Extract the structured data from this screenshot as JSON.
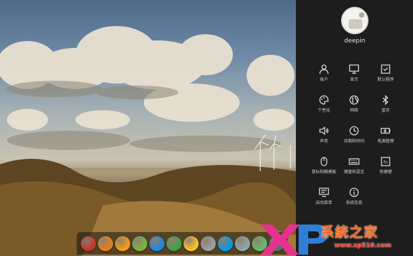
{
  "user": {
    "name": "deepin"
  },
  "settings": [
    {
      "id": "accounts",
      "label": "账户",
      "icon": "user-icon"
    },
    {
      "id": "display",
      "label": "显示",
      "icon": "monitor-icon"
    },
    {
      "id": "default-apps",
      "label": "默认程序",
      "icon": "check-window-icon"
    },
    {
      "id": "personalization",
      "label": "个性化",
      "icon": "palette-icon"
    },
    {
      "id": "network",
      "label": "网络",
      "icon": "globe-icon"
    },
    {
      "id": "bluetooth",
      "label": "蓝牙",
      "icon": "bluetooth-icon"
    },
    {
      "id": "sound",
      "label": "声音",
      "icon": "speaker-icon"
    },
    {
      "id": "datetime",
      "label": "日期和时间",
      "icon": "clock-icon"
    },
    {
      "id": "power",
      "label": "电源管理",
      "icon": "battery-icon"
    },
    {
      "id": "mouse-touchpad",
      "label": "鼠标和触摸板",
      "icon": "mouse-icon"
    },
    {
      "id": "keyboard-language",
      "label": "键盘和语言",
      "icon": "keyboard-icon"
    },
    {
      "id": "shortcuts",
      "label": "快捷键",
      "icon": "fn-key-icon"
    },
    {
      "id": "boot-menu",
      "label": "启动菜单",
      "icon": "boot-screen-icon"
    },
    {
      "id": "system-info",
      "label": "系统信息",
      "icon": "info-icon"
    }
  ],
  "dock": [
    {
      "name": "launcher-icon",
      "color": "#c0392b"
    },
    {
      "name": "store-icon",
      "color": "#e67e22"
    },
    {
      "name": "notes-icon",
      "color": "#f39c12"
    },
    {
      "name": "music-icon",
      "color": "#7cb342"
    },
    {
      "name": "browser-icon",
      "color": "#1e88e5"
    },
    {
      "name": "chrome-icon",
      "color": "#43a047"
    },
    {
      "name": "image-viewer-icon",
      "color": "#fbc02d"
    },
    {
      "name": "settings-icon",
      "color": "#9e9e9e"
    },
    {
      "name": "network-tool-icon",
      "color": "#039be5"
    },
    {
      "name": "disk-icon",
      "color": "#90a4ae"
    },
    {
      "name": "update-icon",
      "color": "#66bb6a"
    },
    {
      "name": "trash-icon",
      "color": "#546e7a"
    }
  ],
  "watermark": {
    "text": "系統之家",
    "url": "www.xp510.com"
  }
}
